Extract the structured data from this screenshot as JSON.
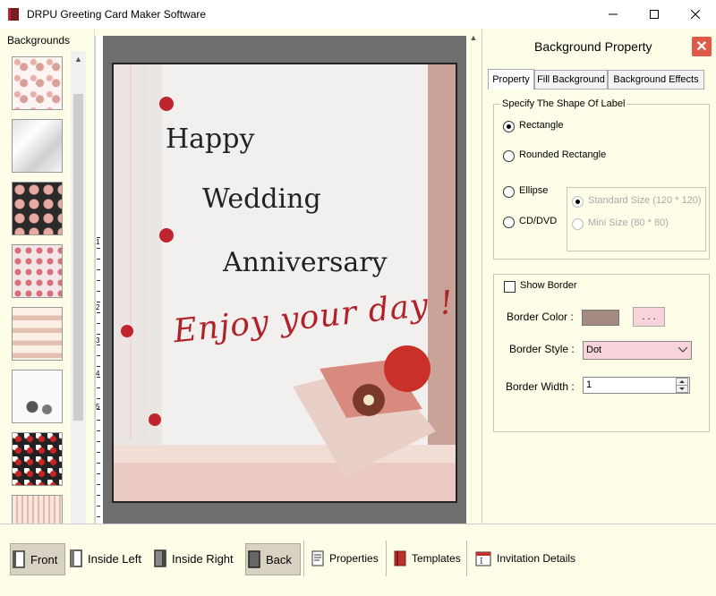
{
  "window": {
    "title": "DRPU Greeting Card Maker Software",
    "min_icon": "minimize-icon",
    "max_icon": "maximize-icon",
    "close_icon": "close-icon"
  },
  "left_panel": {
    "title": "Backgrounds",
    "thumbnails": 8
  },
  "ruler": {
    "numbers": [
      "1",
      "2",
      "3",
      "4",
      "5"
    ]
  },
  "card": {
    "line1": "Happy",
    "line2": "Wedding",
    "line3": "Anniversary",
    "script": "Enjoy your day !"
  },
  "right_panel": {
    "title": "Background Property",
    "tabs": [
      "Property",
      "Fill Background",
      "Background Effects"
    ],
    "shape_group": {
      "legend": "Specify The Shape Of Label",
      "options": [
        "Rectangle",
        "Rounded Rectangle",
        "Ellipse",
        "CD/DVD"
      ],
      "selected": "Rectangle",
      "sizes": [
        "Standard Size (120 * 120)",
        "Mini Size (80 * 80)"
      ]
    },
    "border_group": {
      "show_border": "Show Border",
      "show_border_checked": false,
      "color_label": "Border Color :",
      "color_value": "#a58a84",
      "color_button": ". . .",
      "style_label": "Border Style :",
      "style_value": "Dot",
      "width_label": "Border Width :",
      "width_value": "1"
    }
  },
  "toolbar": {
    "front": "Front",
    "inside_left": "Inside Left",
    "inside_right": "Inside Right",
    "back": "Back",
    "properties": "Properties",
    "templates": "Templates",
    "invitation": "Invitation Details"
  }
}
